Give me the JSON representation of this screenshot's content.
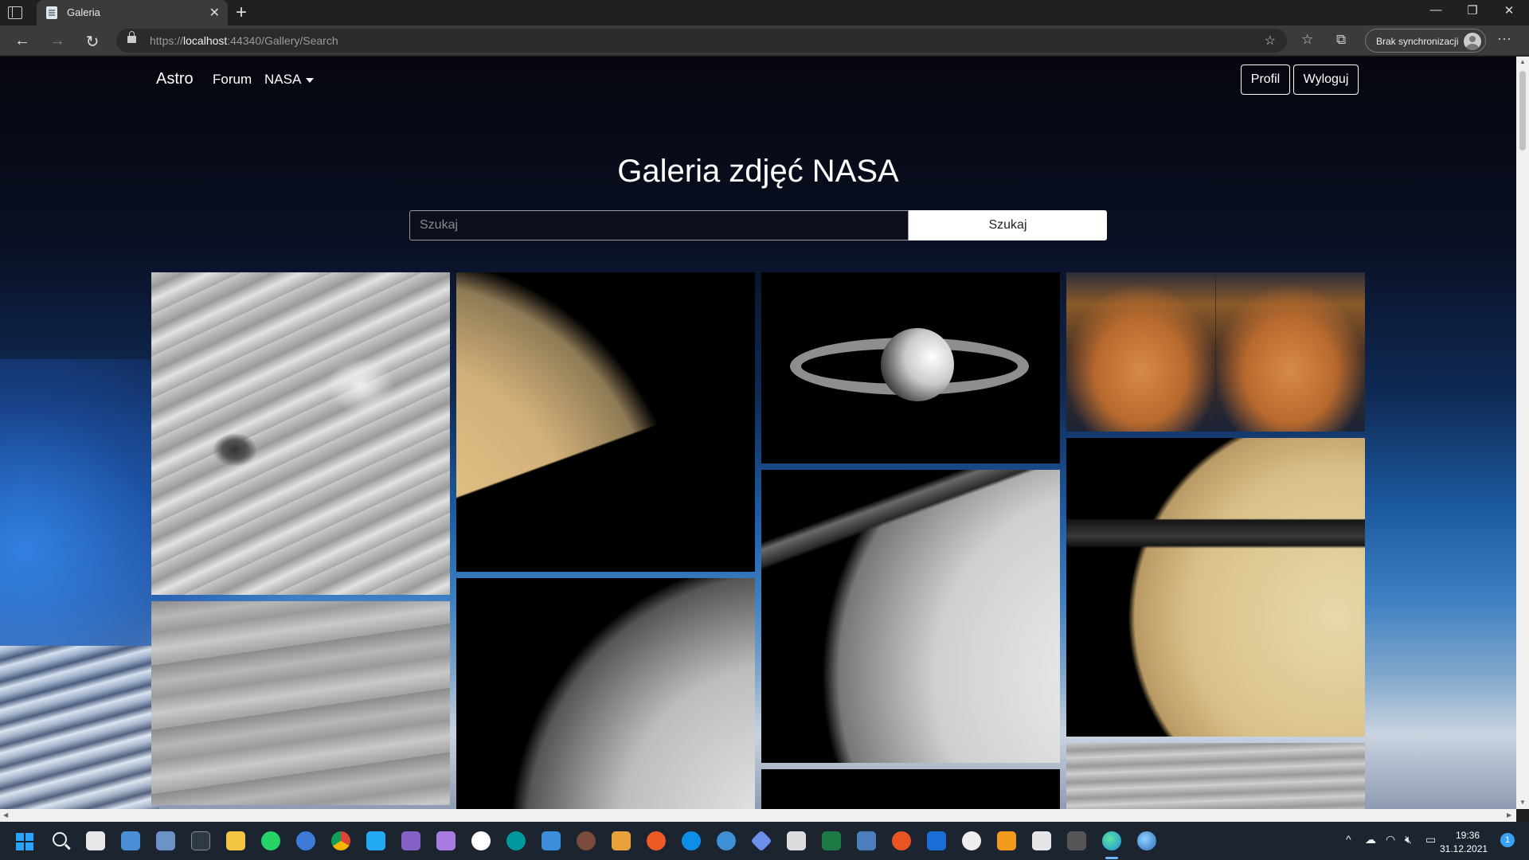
{
  "browser": {
    "tab_title": "Galeria",
    "tab_close": "✕",
    "new_tab": "+",
    "url_scheme": "https://",
    "url_host": "localhost",
    "url_rest": ":44340/Gallery/Search",
    "profile_label": "Brak synchronizacji",
    "window_minimize": "—",
    "window_restore": "❐",
    "window_close": "✕",
    "back": "←",
    "forward": "→",
    "refresh": "↻",
    "more": "···",
    "icons": [
      "favorites-add-icon",
      "favorites-icon",
      "collections-icon",
      "lock-icon"
    ]
  },
  "navbar": {
    "brand": "Astro",
    "links": [
      "Forum",
      "NASA"
    ],
    "profile_button": "Profil",
    "logout_button": "Wyloguj"
  },
  "page": {
    "title": "Galeria zdjęć NASA",
    "search_placeholder": "Szukaj",
    "search_button": "Szukaj"
  },
  "gallery": {
    "images": [
      {
        "subject": "jupiter-storm-bw"
      },
      {
        "subject": "saturn-closeup-color"
      },
      {
        "subject": "saturn-small-with-rings"
      },
      {
        "subject": "saturn-aurora-pair"
      },
      {
        "subject": "saturn-band-gray"
      },
      {
        "subject": "saturn-bw-rings-crescent"
      },
      {
        "subject": "saturn-bw-large"
      },
      {
        "subject": "saturn-color-with-moon"
      },
      {
        "subject": "dark-space"
      },
      {
        "subject": "venus-clouds-gray"
      }
    ]
  },
  "taskbar": {
    "clock_time": "19:36",
    "clock_date": "31.12.2021",
    "notification_count": "1",
    "apps": [
      "start",
      "search",
      "snipping-tool",
      "control-panel",
      "resource-monitor",
      "terminal",
      "file-explorer",
      "whatsapp",
      "edge-dev",
      "chrome",
      "vscode",
      "visual-studio",
      "visual-studio-preview",
      "app-w",
      "arduino",
      "intellij-ide",
      "app-person",
      "xampp",
      "postman",
      "teamviewer",
      "app-globe",
      "app-diamond",
      "app-m",
      "excel",
      "app-network",
      "ubuntu",
      "app-blue",
      "obs",
      "app-orange",
      "unity",
      "app-x",
      "edge",
      "app-earth"
    ],
    "colors": {
      "background": "#1c2430",
      "accent": "#3aa0f3"
    }
  }
}
